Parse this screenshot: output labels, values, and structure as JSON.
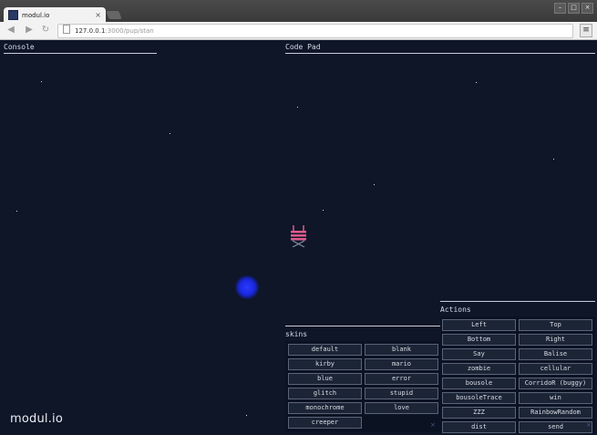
{
  "browser": {
    "tab_title": "modul.io",
    "tab_close": "×",
    "url_host": "127.0.0.1",
    "url_path": ":3000/pup/stan",
    "window_buttons": [
      "–",
      "□",
      "×"
    ],
    "menu_icon": "≡"
  },
  "page": {
    "console_title": "Console",
    "codepad_title": "Code Pad",
    "actions_title": "Actions",
    "skins_title": "skins",
    "logo": "modul.io",
    "close_symbol": "×"
  },
  "skins": [
    "default",
    "blank",
    "kirby",
    "mario",
    "blue",
    "error",
    "glitch",
    "stupid",
    "monochrome",
    "love",
    "creeper"
  ],
  "actions": [
    "Left",
    "Top",
    "Bottom",
    "Right",
    "Say",
    "Balise",
    "zombie",
    "cellular",
    "bousole",
    "CorridoR (buggy)",
    "bousoleTrace",
    "win",
    "ZZZ",
    "RainbowRandom",
    "dist",
    "send"
  ],
  "colors": {
    "background": "#0e1628",
    "player_blob": "#1a28e0",
    "sprite": "#e05a8a"
  }
}
